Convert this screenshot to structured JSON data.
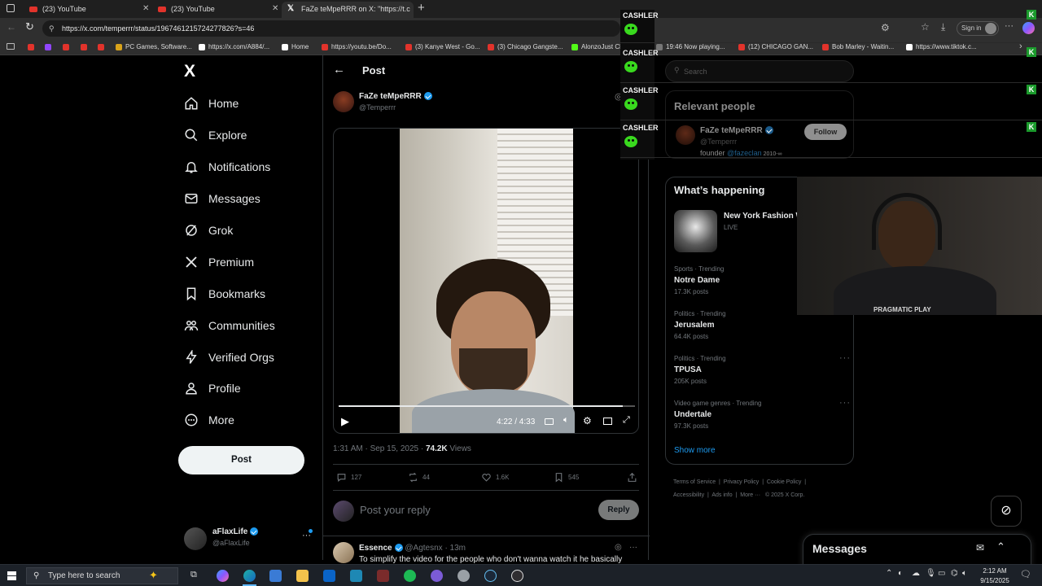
{
  "browser": {
    "tabs": [
      {
        "title": "(23) YouTube"
      },
      {
        "title": "(23) YouTube"
      },
      {
        "title": "FaZe teMpeRRR on X: \"https://t.c"
      }
    ],
    "url": "https://x.com/temperrr/status/1967461215724277826?s=46",
    "sign_in": "Sign in",
    "bookmarks": [
      "PC Games, Software...",
      "https://x.com/A884/...",
      "Home",
      "https://youtu.be/Do...",
      "(3) Kanye West - Go...",
      "(3) Chicago Gangste...",
      "AlonzoJust Chattin...",
      "19:46 Now playing...",
      "(12) CHICAGO GAN...",
      "Bob Marley - Waitin...",
      "https://www.tiktok.c..."
    ]
  },
  "nav": {
    "logo": "X",
    "items": [
      {
        "label": "Home",
        "icon": "home-icon"
      },
      {
        "label": "Explore",
        "icon": "search-icon"
      },
      {
        "label": "Notifications",
        "icon": "bell-icon"
      },
      {
        "label": "Messages",
        "icon": "mail-icon"
      },
      {
        "label": "Grok",
        "icon": "grok-icon"
      },
      {
        "label": "Premium",
        "icon": "x-icon"
      },
      {
        "label": "Bookmarks",
        "icon": "bookmark-icon"
      },
      {
        "label": "Communities",
        "icon": "people-icon"
      },
      {
        "label": "Verified Orgs",
        "icon": "lightning-icon"
      },
      {
        "label": "Profile",
        "icon": "person-icon"
      },
      {
        "label": "More",
        "icon": "more-icon"
      }
    ],
    "post_button": "Post",
    "account": {
      "name": "aFlaxLife",
      "handle": "@aFlaxLife"
    }
  },
  "post": {
    "header": "Post",
    "author": {
      "name": "FaZe teMpeRRR",
      "handle": "@Temperrr"
    },
    "video": {
      "time": "4:22 / 4:33",
      "progress": 0.96
    },
    "timestamp": "1:31 AM · Sep 15, 2025 · ",
    "views_count": "74.2K",
    "views_label": " Views",
    "actions": {
      "replies": "127",
      "reposts": "44",
      "likes": "1.6K",
      "bookmarks": "545"
    },
    "reply_placeholder": "Post your reply",
    "reply_button": "Reply",
    "reply": {
      "name": "Essence",
      "handle": "@Agtesnx · 13m",
      "text": "To simplify the video for the people who don't wanna watch it he basically"
    }
  },
  "sidebar": {
    "search_placeholder": "Search",
    "relevant_title": "Relevant people",
    "relevant_person": {
      "name": "FaZe teMpeRRR",
      "handle": "@Temperrr",
      "bio_prefix": "founder ",
      "bio_link": "@fazeclan",
      "bio_suffix": " 2010-∞",
      "follow": "Follow"
    },
    "happening_title": "What’s happening",
    "event": {
      "title": "New York Fashion W",
      "status": "LIVE"
    },
    "trends": [
      {
        "category": "Sports · Trending",
        "title": "Notre Dame",
        "count": "17.3K posts"
      },
      {
        "category": "Politics · Trending",
        "title": "Jerusalem",
        "count": "64.4K posts"
      },
      {
        "category": "Politics · Trending",
        "title": "TPUSA",
        "count": "205K posts"
      },
      {
        "category": "Video game genres · Trending",
        "title": "Undertale",
        "count": "97.3K posts"
      }
    ],
    "show_more": "Show more",
    "footer": [
      "Terms of Service",
      "Privacy Policy",
      "Cookie Policy",
      "Accessibility",
      "Ads info",
      "More ···",
      "© 2025 X Corp."
    ],
    "messages": "Messages"
  },
  "overlay": {
    "cashler": "CASHLER",
    "k_badge": "K",
    "webcam_logo": "PRAGMATIC PLAY"
  },
  "taskbar": {
    "search_placeholder": "Type here to search",
    "time": "2:12 AM",
    "date": "9/15/2025"
  },
  "colors": {
    "accent": "#1d9bf0",
    "background": "#000000",
    "text": "#e7e9ea",
    "muted": "#71767b"
  }
}
